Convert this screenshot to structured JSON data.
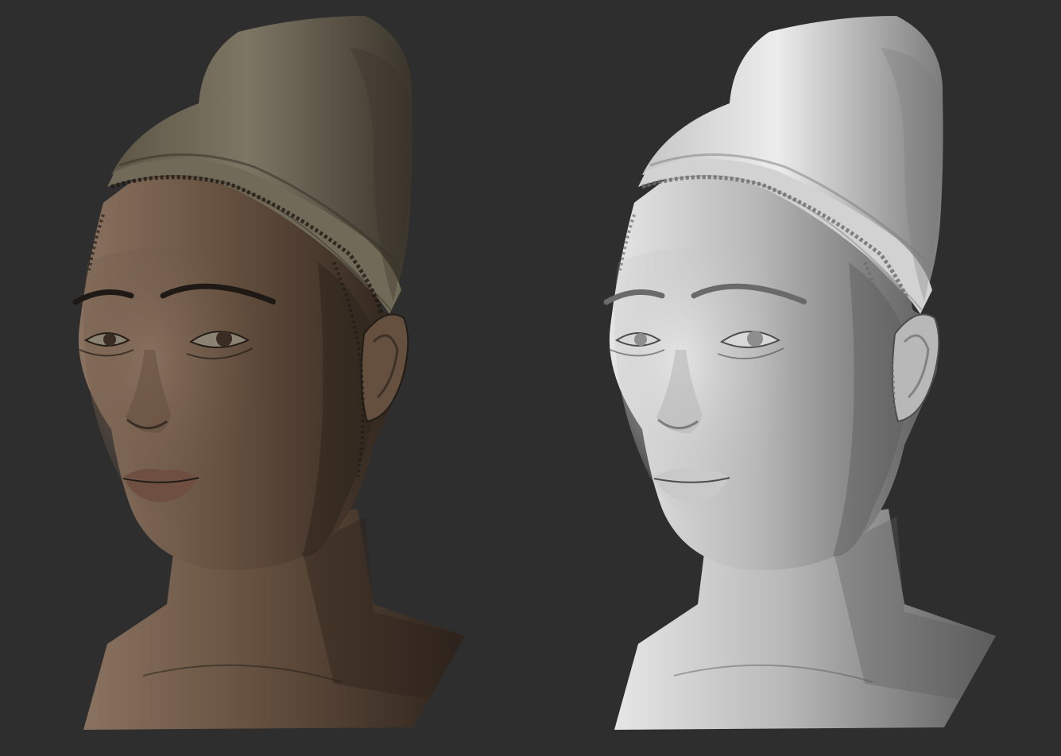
{
  "viewport": {
    "background": "#2e2e2e"
  },
  "renders": [
    {
      "name": "textured-scan",
      "palette": {
        "skin_light": "#8a7260",
        "skin_mid": "#65503f",
        "skin_dark": "#2e241c",
        "wrap_light": "#7e7664",
        "wrap_mid": "#5d5646",
        "wrap_dark": "#3a352b",
        "band": "#726a58",
        "lips": "#6e4f42",
        "eye_white": "#8c8273",
        "iris": "#3a2c22",
        "hair": "#1e1914",
        "detail": "#221c16"
      }
    },
    {
      "name": "clay-scan",
      "palette": {
        "skin_light": "#e6e6e6",
        "skin_mid": "#b8b8b8",
        "skin_dark": "#5c5c5c",
        "wrap_light": "#ececec",
        "wrap_mid": "#c6c6c6",
        "wrap_dark": "#7c7c7c",
        "band": "#d2d2d2",
        "lips": "#c9c9c9",
        "eye_white": "#d8d8d8",
        "iris": "#8e8e8e",
        "hair": "#6a6a6a",
        "detail": "#4c4c4c"
      }
    }
  ]
}
